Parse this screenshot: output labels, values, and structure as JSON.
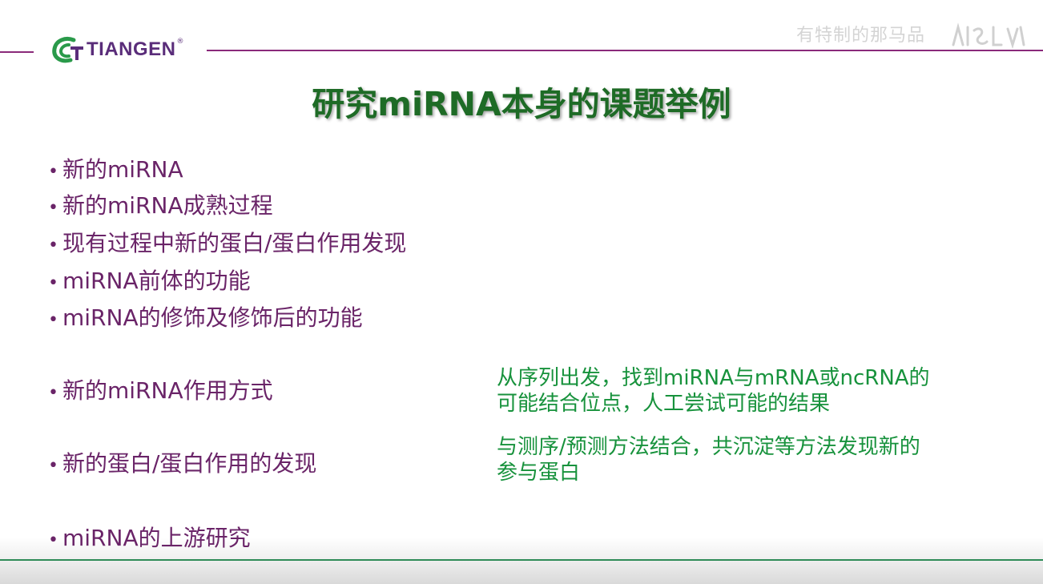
{
  "header": {
    "logo_text": "TIANGEN",
    "logo_reg": "®",
    "watermark_text": "有特制的那马品"
  },
  "title": "研究miRNA本身的课题举例",
  "bullets": [
    "新的miRNA",
    "新的miRNA成熟过程",
    "现有过程中新的蛋白/蛋白作用发现",
    "miRNA前体的功能",
    "miRNA的修饰及修饰后的功能",
    "新的miRNA作用方式",
    "新的蛋白/蛋白作用的发现",
    "miRNA的上游研究"
  ],
  "bullet_symbol": "•",
  "notes": [
    {
      "line1": "从序列出发，找到miRNA与mRNA或ncRNA的",
      "line2": "可能结合位点，人工尝试可能的结果"
    },
    {
      "line1": "与测序/预测方法结合，共沉淀等方法发现新的",
      "line2": "参与蛋白"
    }
  ],
  "colors": {
    "title": "#1e6b26",
    "bullet_text": "#6a2468",
    "note_text": "#17923c",
    "header_rule": "#8a2a7a",
    "footer_rule": "#2e8b57"
  }
}
